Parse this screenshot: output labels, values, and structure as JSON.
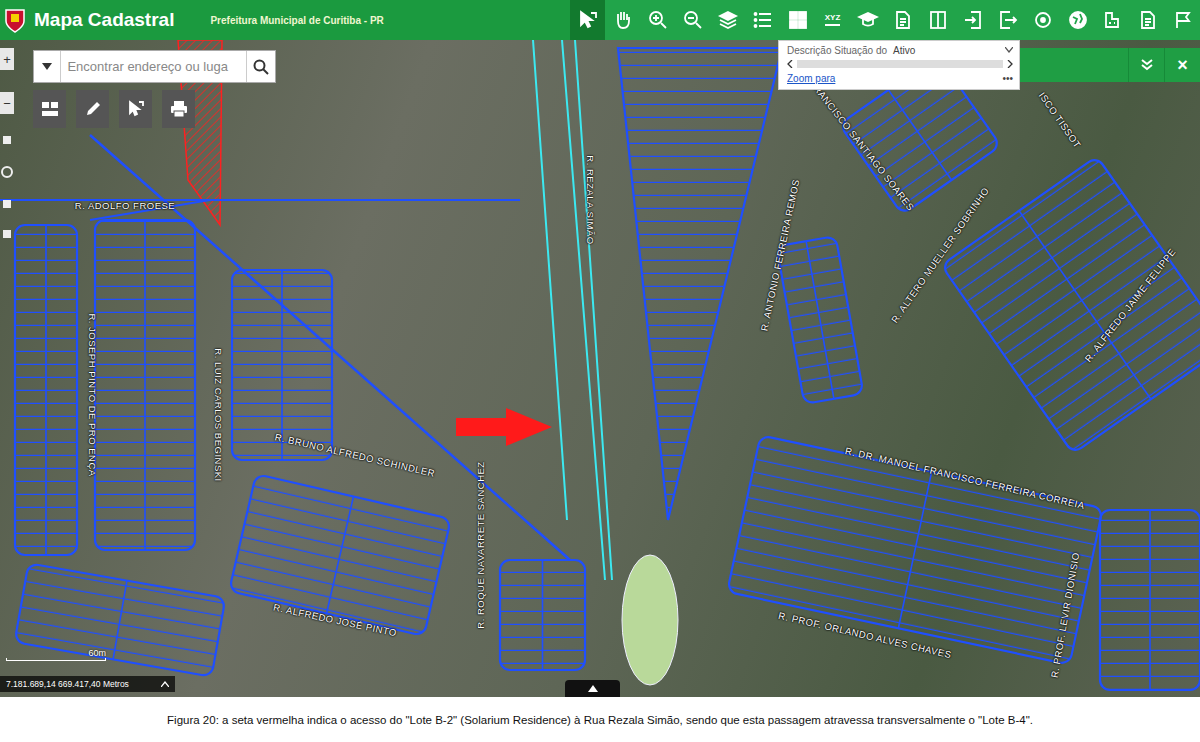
{
  "header": {
    "title": "Mapa Cadastral",
    "subtitle": "Prefeitura Municipal de Curitiba - PR",
    "tools": [
      {
        "kind": "select",
        "selected": true,
        "label": ""
      },
      {
        "kind": "hand",
        "selected": false,
        "label": ""
      },
      {
        "kind": "zoom-in",
        "selected": false,
        "label": ""
      },
      {
        "kind": "zoom-out",
        "selected": false,
        "label": ""
      },
      {
        "kind": "layers",
        "selected": false,
        "label": ""
      },
      {
        "kind": "list",
        "selected": false,
        "label": ""
      },
      {
        "kind": "grid",
        "selected": false,
        "label": ""
      },
      {
        "kind": "xyz",
        "selected": false,
        "label": "XYZ"
      },
      {
        "kind": "cap",
        "selected": false,
        "label": ""
      },
      {
        "kind": "doc",
        "selected": false,
        "label": ""
      },
      {
        "kind": "split",
        "selected": false,
        "label": ""
      },
      {
        "kind": "enter",
        "selected": false,
        "label": ""
      },
      {
        "kind": "exit",
        "selected": false,
        "label": ""
      },
      {
        "kind": "target",
        "selected": false,
        "label": ""
      },
      {
        "kind": "globe",
        "selected": false,
        "label": ""
      },
      {
        "kind": "measure",
        "selected": false,
        "label": ""
      },
      {
        "kind": "doc",
        "selected": false,
        "label": ""
      },
      {
        "kind": "flag",
        "selected": false,
        "label": ""
      }
    ]
  },
  "search": {
    "placeholder": "Encontrar endereço ou luga"
  },
  "left_strip": {
    "zoom_in": "+",
    "zoom_out": "−"
  },
  "popup": {
    "label": "Descrição Situação do",
    "value": "Ativo",
    "link": "Zoom para",
    "more": "•••"
  },
  "panel_bar": {
    "close": "×"
  },
  "streets": [
    {
      "name": "R. ADOLFO FROESE"
    },
    {
      "name": "R. JOSEPH PINTO DE PRO ENÇA"
    },
    {
      "name": "R. LUIZ CARLOS BEGINSKI"
    },
    {
      "name": "R. BRUNO ALFREDO SCHINDLER"
    },
    {
      "name": "R. ROQUE NAVARRETE SANCHEZ"
    },
    {
      "name": "R. ALFREDO JOSÉ PINTO"
    },
    {
      "name": "R. REZALA SIMÃO"
    },
    {
      "name": "R. FRANCISCO SANTIAGO SOARES"
    },
    {
      "name": "R. ANTONIO FERREIRA REMOS"
    },
    {
      "name": "R. ALTERO MUELLER SOBRINHO"
    },
    {
      "name": "ISCO TISSOT"
    },
    {
      "name": "R. ALFREDO JAIME FELIPPE"
    },
    {
      "name": "R. DR. MANOEL FRANCISCO FERREIRA CORREIA"
    },
    {
      "name": "R. PROF. ORLANDO ALVES CHAVES"
    },
    {
      "name": "R. PROF. LEVIR DIONISIO"
    }
  ],
  "scale": {
    "label": "60m"
  },
  "coordinates": "7.181.689,14 669.417,40 Metros",
  "caption": "Figura 20: a seta vermelha indica o acesso do \"Lote B-2\" (Solarium Residence) à Rua Rezala Simão, sendo que esta passagem atravessa transversalmente o \"Lote B-4\"."
}
